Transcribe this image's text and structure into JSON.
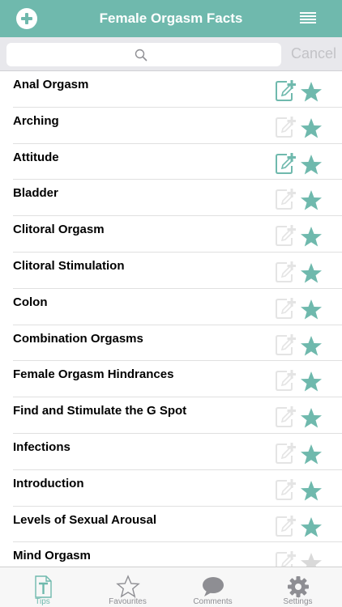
{
  "nav": {
    "title": "Female Orgasm Facts",
    "add_icon": "plus-circle-icon",
    "menu_icon": "hamburger-menu-icon"
  },
  "search": {
    "value": "",
    "placeholder": "",
    "cancel_label": "Cancel"
  },
  "colors": {
    "accent": "#6fb9ad",
    "inactive": "#e4e4e4",
    "star_faded": "#d9d9d9"
  },
  "list": {
    "items": [
      {
        "label": "Anal Orgasm",
        "note_active": true
      },
      {
        "label": "Arching",
        "note_active": false
      },
      {
        "label": "Attitude",
        "note_active": true
      },
      {
        "label": "Bladder",
        "note_active": false
      },
      {
        "label": "Clitoral Orgasm",
        "note_active": false
      },
      {
        "label": "Clitoral Stimulation",
        "note_active": false
      },
      {
        "label": "Colon",
        "note_active": false
      },
      {
        "label": "Combination Orgasms",
        "note_active": false
      },
      {
        "label": "Female Orgasm Hindrances",
        "note_active": false
      },
      {
        "label": "Find and Stimulate the G Spot",
        "note_active": false
      },
      {
        "label": "Infections",
        "note_active": false
      },
      {
        "label": "Introduction",
        "note_active": false
      },
      {
        "label": "Levels of Sexual Arousal",
        "note_active": false
      },
      {
        "label": "Mind Orgasm",
        "note_active": false
      }
    ]
  },
  "tabs": [
    {
      "label": "Tips",
      "icon": "tips-document-icon",
      "active": true
    },
    {
      "label": "Favourites",
      "icon": "star-outline-icon",
      "active": false
    },
    {
      "label": "Comments",
      "icon": "speech-bubble-icon",
      "active": false
    },
    {
      "label": "Settings",
      "icon": "gear-icon",
      "active": false
    }
  ]
}
